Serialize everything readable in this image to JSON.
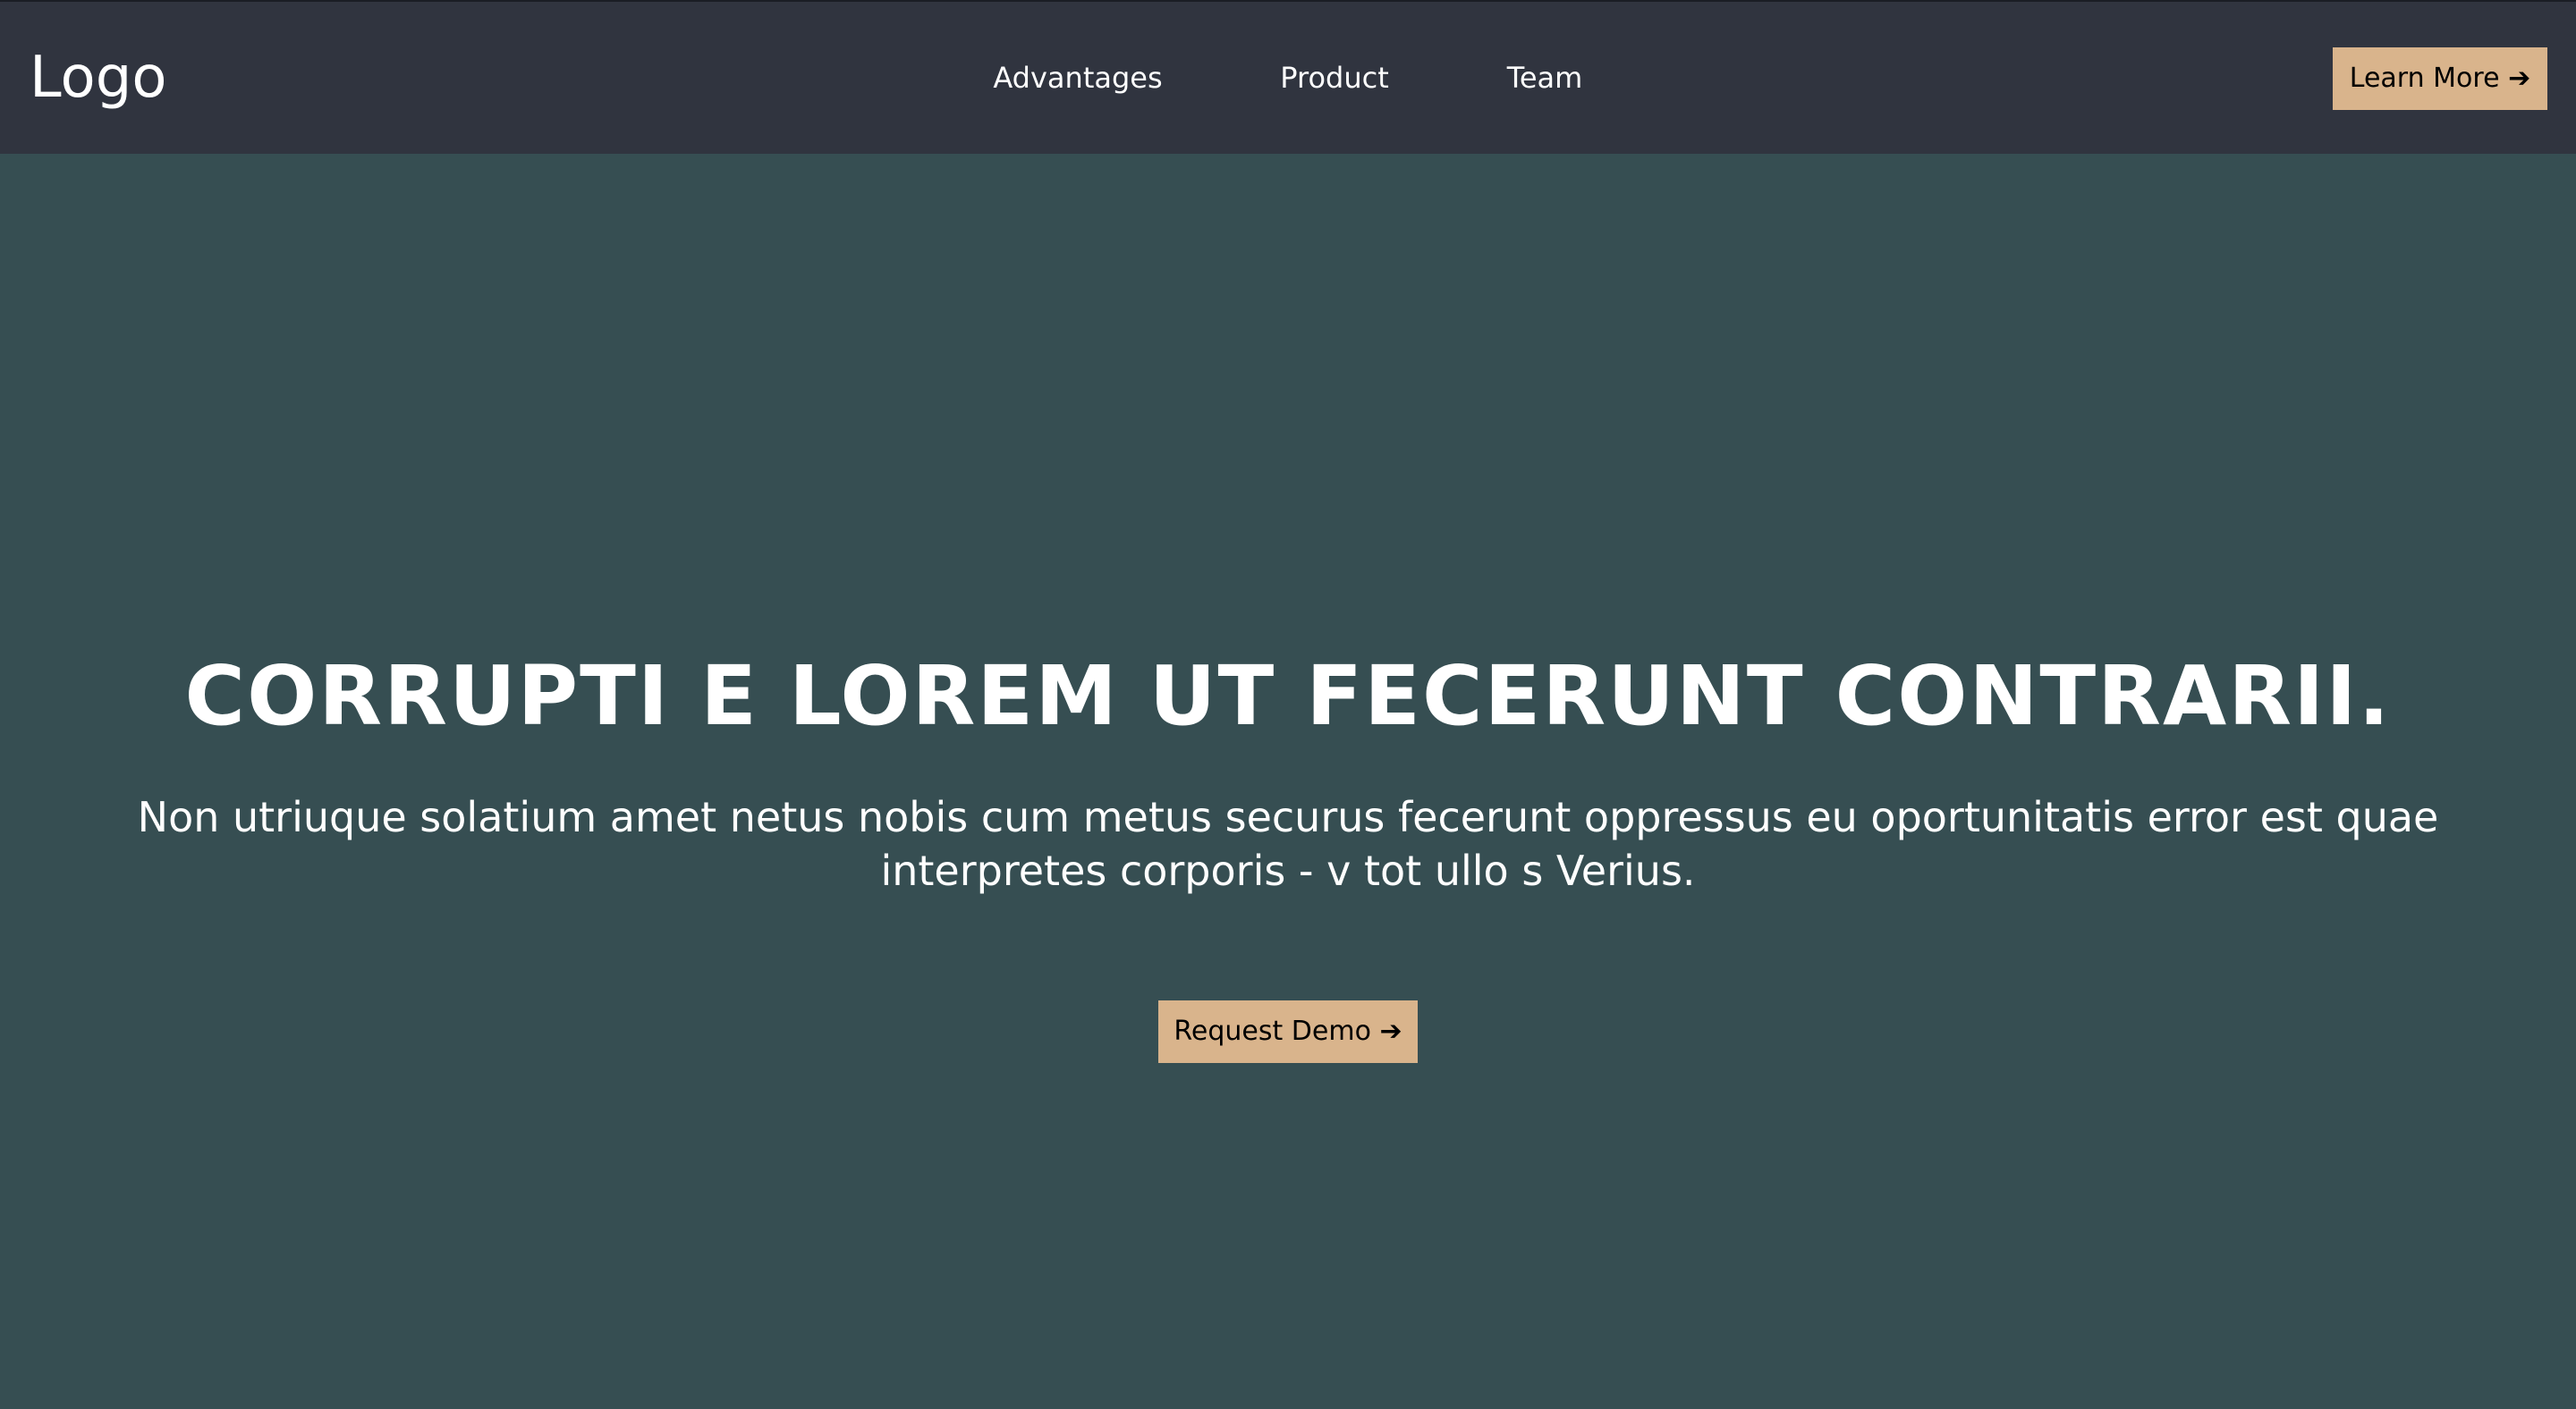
{
  "header": {
    "logo": "Logo",
    "nav": [
      {
        "label": "Advantages"
      },
      {
        "label": "Product"
      },
      {
        "label": "Team"
      }
    ],
    "cta_label": "Learn More ➔"
  },
  "hero": {
    "title": "Corrupti e lorem ut fecerunt contrarii.",
    "subtitle": "Non utriuque solatium amet netus nobis cum metus securus fecerunt oppressus eu oportunitatis error est quae interpretes corporis - v tot ullo s Verius.",
    "cta_label": "Request Demo ➔"
  },
  "colors": {
    "background": "#364e52",
    "navbar": "#30343f",
    "accent_button": "#d9b48c",
    "text": "#ffffff",
    "button_text": "#000000"
  }
}
